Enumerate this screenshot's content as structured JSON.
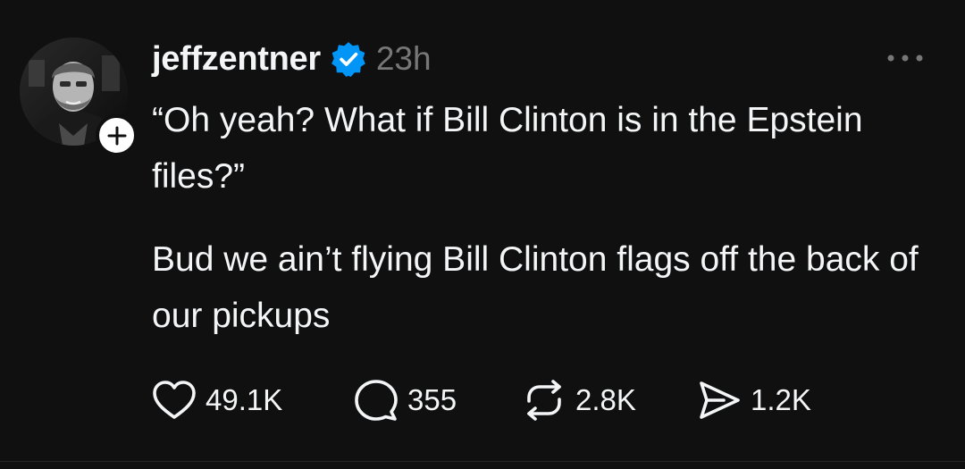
{
  "post": {
    "username": "jeffzentner",
    "verified": true,
    "timestamp": "23h",
    "paragraphs": [
      "“Oh yeah? What if Bill Clinton is in the Epstein files?”",
      "Bud we ain’t flying Bill Clinton flags off the back of our pickups"
    ],
    "actions": {
      "likes": "49.1K",
      "replies": "355",
      "reposts": "2.8K",
      "shares": "1.2K"
    }
  },
  "icons": {
    "avatar": "avatar-photo",
    "follow": "plus-icon",
    "verified": "verified-badge-icon",
    "more": "more-horizontal-icon",
    "like": "heart-icon",
    "reply": "comment-icon",
    "repost": "repost-icon",
    "share": "send-icon"
  },
  "colors": {
    "background": "#101010",
    "text": "#f3f5f7",
    "muted": "#777777",
    "verified": "#0095f6"
  }
}
